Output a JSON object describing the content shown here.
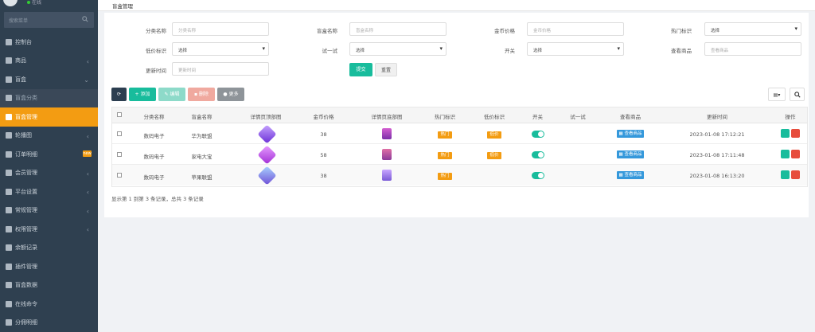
{
  "sidebar": {
    "online": "在线",
    "search_placeholder": "搜索菜单",
    "items": [
      {
        "label": "控制台",
        "icon": "dashboard-icon"
      },
      {
        "label": "商品",
        "icon": "shopping-bag-icon"
      },
      {
        "label": "盲盒",
        "icon": "box-icon"
      },
      {
        "label": "盲盒分类",
        "icon": "list-icon"
      },
      {
        "label": "盲盒管理",
        "icon": "cubes-icon"
      },
      {
        "label": "轮播图",
        "icon": "eye-icon"
      },
      {
        "label": "订单明细",
        "icon": "cart-icon",
        "badge": "new"
      },
      {
        "label": "会员管理",
        "icon": "users-icon"
      },
      {
        "label": "平台设置",
        "icon": "gear-icon"
      },
      {
        "label": "常规管理",
        "icon": "cogs-icon"
      },
      {
        "label": "权限管理",
        "icon": "group-icon"
      },
      {
        "label": "余额记录",
        "icon": "yen-icon"
      },
      {
        "label": "插件管理",
        "icon": "rocket-icon"
      },
      {
        "label": "盲盒数据",
        "icon": "circle-icon"
      },
      {
        "label": "在线命令",
        "icon": "terminal-icon"
      },
      {
        "label": "分佣明细",
        "icon": "team-icon"
      }
    ]
  },
  "breadcrumb": "盲盒管理",
  "filters": {
    "category_name": {
      "label": "分类名称",
      "placeholder": "分类名称"
    },
    "box_name": {
      "label": "盲盒名称",
      "placeholder": "盲盒名称"
    },
    "coin_price": {
      "label": "金币价格",
      "placeholder": "金币价格"
    },
    "hot_tag": {
      "label": "热门标识",
      "value": "选择"
    },
    "low_price_tag": {
      "label": "低价标识",
      "value": "选择"
    },
    "try_once": {
      "label": "试一试",
      "value": "选择"
    },
    "switch": {
      "label": "开关",
      "value": "选择"
    },
    "view_goods": {
      "label": "查看商品",
      "placeholder": "查看商品"
    },
    "update_time": {
      "label": "更新时间",
      "placeholder": "更新时间"
    },
    "submit": "提交",
    "reset": "重置"
  },
  "toolbar": {
    "add": "添加",
    "edit": "编辑",
    "delete": "删除",
    "more": "更多"
  },
  "table": {
    "headers": [
      "分类名称",
      "盲盒名称",
      "详情页顶部图",
      "金币价格",
      "详情页底部图",
      "热门标识",
      "低价标识",
      "开关",
      "试一试",
      "查看商品",
      "更新时间",
      "操作"
    ],
    "rows": [
      {
        "category": "数码电子",
        "name": "华为联盟",
        "price": "38",
        "hot": "热门",
        "low": "低价",
        "switch": "on",
        "view": "查看商品",
        "time": "2023-01-08 17:12:21"
      },
      {
        "category": "数码电子",
        "name": "家电大宝",
        "price": "58",
        "hot": "热门",
        "low": "低价",
        "switch": "on",
        "view": "查看商品",
        "time": "2023-01-08 17:11:48"
      },
      {
        "category": "数码电子",
        "name": "苹果联盟",
        "price": "38",
        "hot": "热门",
        "low": "",
        "switch": "on",
        "view": "查看商品",
        "time": "2023-01-08 16:13:20"
      }
    ]
  },
  "pagination": "显示第 1 到第 3 条记录，总共 3 条记录",
  "colors": {
    "sidebar": "#2f4050",
    "active": "#f39c12",
    "primary": "#18bc9c",
    "blue": "#3498db",
    "danger": "#e74c3c"
  }
}
